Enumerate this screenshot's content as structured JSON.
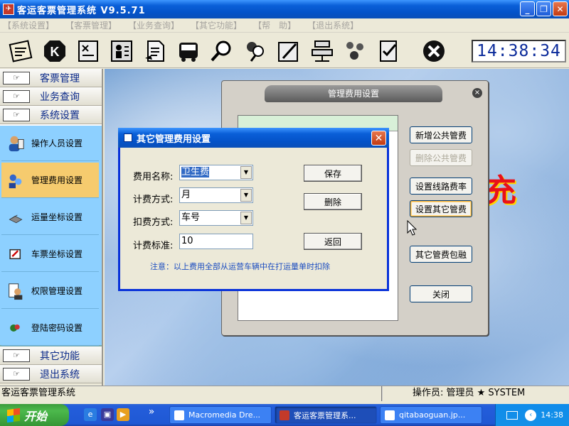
{
  "window": {
    "title": "客运客票管理系统 V9.5.71",
    "minimize_glyph": "_",
    "maximize_glyph": "❐",
    "close_glyph": "✕"
  },
  "menu": [
    "【系统设置】",
    "【客票管理】",
    "【业务查询】",
    "【其它功能】",
    "【帮　助】",
    "【退出系统】"
  ],
  "toolbar": {
    "icons": [
      "ticket-icon",
      "k-icon",
      "tools-icon",
      "person-card-icon",
      "document-icon",
      "bus-icon",
      "magnifier-icon",
      "people-search-icon",
      "pen-icon",
      "network-icon",
      "users-icon",
      "checklist-icon",
      "close-circle-icon"
    ],
    "clock": "14:38:34"
  },
  "sidebar": {
    "hand_glyph": "☞",
    "headers_top": [
      "客票管理",
      "业务查询",
      "系统设置"
    ],
    "items": [
      {
        "label": "操作人员设置",
        "icon": "operator-icon"
      },
      {
        "label": "管理费用设置",
        "icon": "fee-settings-icon"
      },
      {
        "label": "运量坐标设置",
        "icon": "traffic-coordinate-icon"
      },
      {
        "label": "车票坐标设置",
        "icon": "ticket-coordinate-icon"
      },
      {
        "label": "权限管理设置",
        "icon": "permission-icon"
      },
      {
        "label": "登陆密码设置",
        "icon": "password-icon"
      }
    ],
    "headers_bottom": [
      "其它功能",
      "退出系统"
    ]
  },
  "background_char": "充",
  "bg_dialog": {
    "title": "管理费用设置",
    "close_glyph": "×",
    "buttons": {
      "add_public": "新增公共管费",
      "delete_public": "删除公共管费",
      "set_route": "设置线路费率",
      "set_other": "设置其它管费",
      "other_package": "其它管费包融",
      "close": "关闭"
    }
  },
  "fg_dialog": {
    "title": "其它管理费用设置",
    "close_glyph": "✕",
    "dropdown_glyph": "▼",
    "fields": {
      "fee_name_label": "费用名称:",
      "fee_name_value": "卫生费",
      "billing_method_label": "计费方式:",
      "billing_method_value": "月",
      "deduct_method_label": "扣费方式:",
      "deduct_method_value": "车号",
      "standard_label": "计费标准:",
      "standard_value": "10"
    },
    "buttons": {
      "save": "保存",
      "delete": "删除",
      "back": "返回"
    },
    "note": "注意：以上费用全部从运营车辆中在打运量单时扣除"
  },
  "statusbar": {
    "left": "客运客票管理系统",
    "right": "操作员: 管理员 ★ SYSTEM"
  },
  "taskbar": {
    "start": "开始",
    "tasks": [
      "Macromedia Dre...",
      "客运客票管理系...",
      "qitabaoguan.jp..."
    ],
    "time": "14:38",
    "expand_glyph": "»",
    "tray_arrow": "‹"
  }
}
